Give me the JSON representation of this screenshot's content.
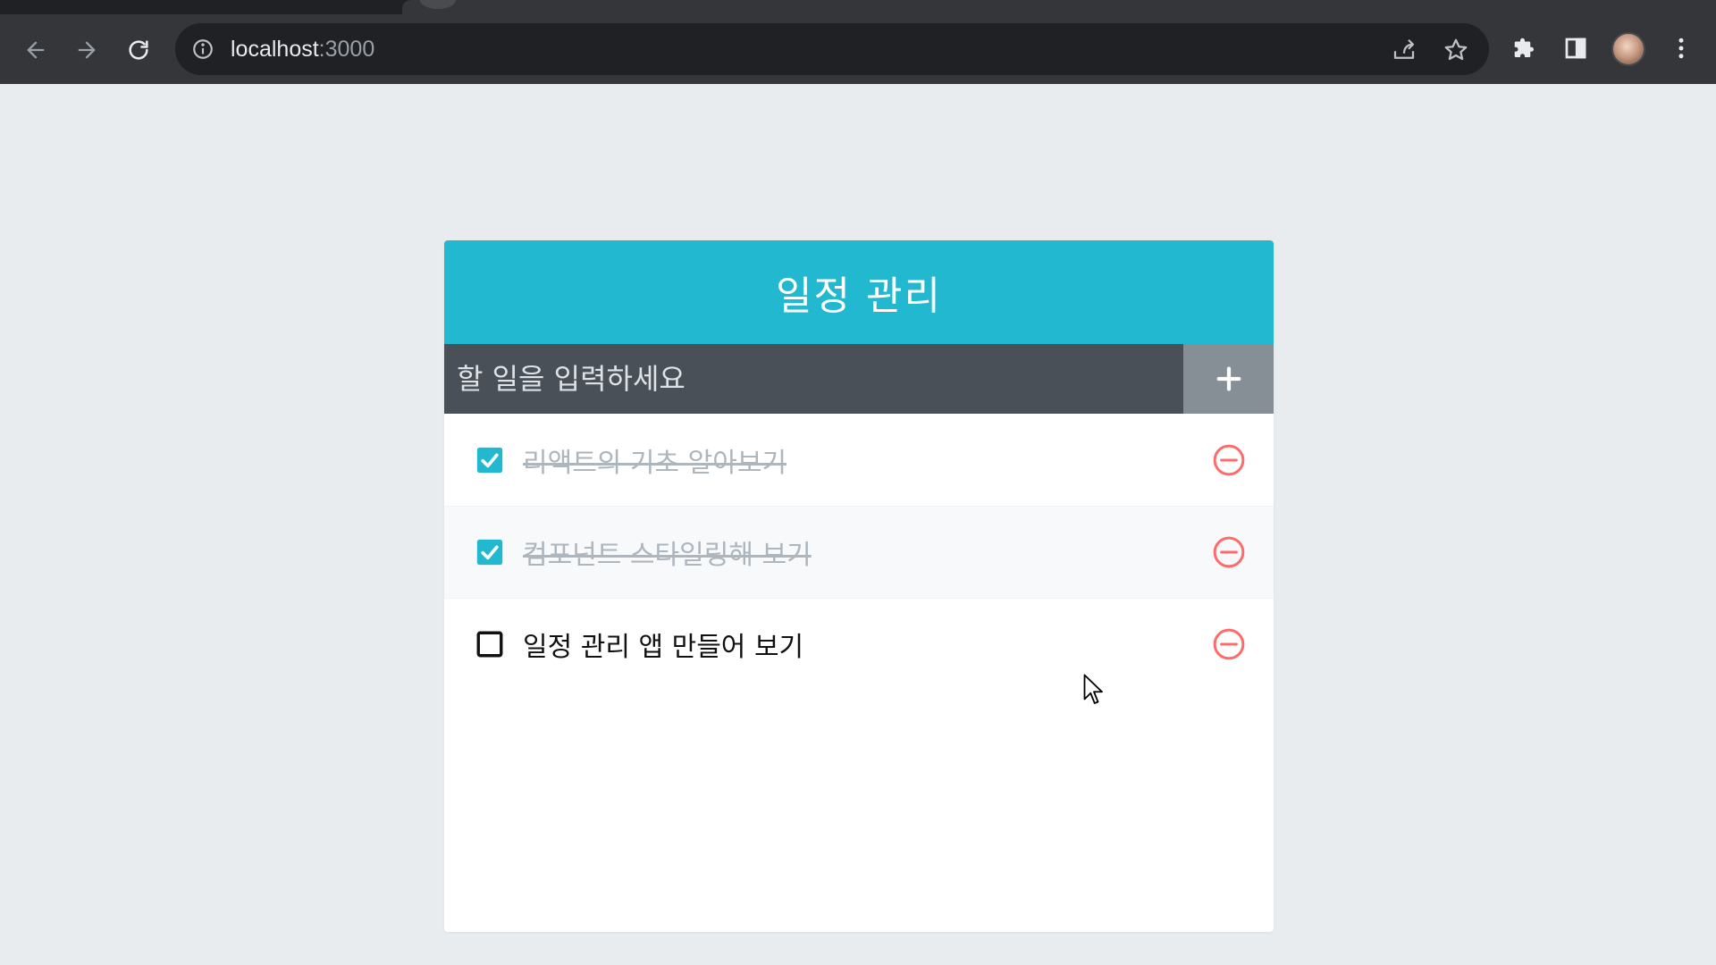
{
  "browser": {
    "url_host": "localhost",
    "url_port": ":3000"
  },
  "app": {
    "title": "일정 관리",
    "input_placeholder": "할 일을 입력하세요",
    "input_value": "",
    "colors": {
      "header": "#22b8cf",
      "input_bar": "#495057",
      "add_button": "#868e96",
      "remove": "#ff6b6b",
      "checked": "#22b8cf"
    }
  },
  "todos": [
    {
      "text": "리액트의 기초 알아보기",
      "checked": true
    },
    {
      "text": "컴포넌트 스타일링해 보기",
      "checked": true
    },
    {
      "text": "일정 관리 앱 만들어 보기",
      "checked": false
    }
  ],
  "icons": {
    "back": "arrow-left-icon",
    "forward": "arrow-right-icon",
    "reload": "reload-icon",
    "info": "info-icon",
    "share": "share-icon",
    "bookmark": "star-icon",
    "extensions": "puzzle-icon",
    "side_panel": "side-panel-icon",
    "menu": "kebab-menu-icon",
    "add": "plus-icon",
    "remove": "minus-circle-icon",
    "checked": "checkbox-checked-icon",
    "unchecked": "checkbox-blank-icon"
  }
}
